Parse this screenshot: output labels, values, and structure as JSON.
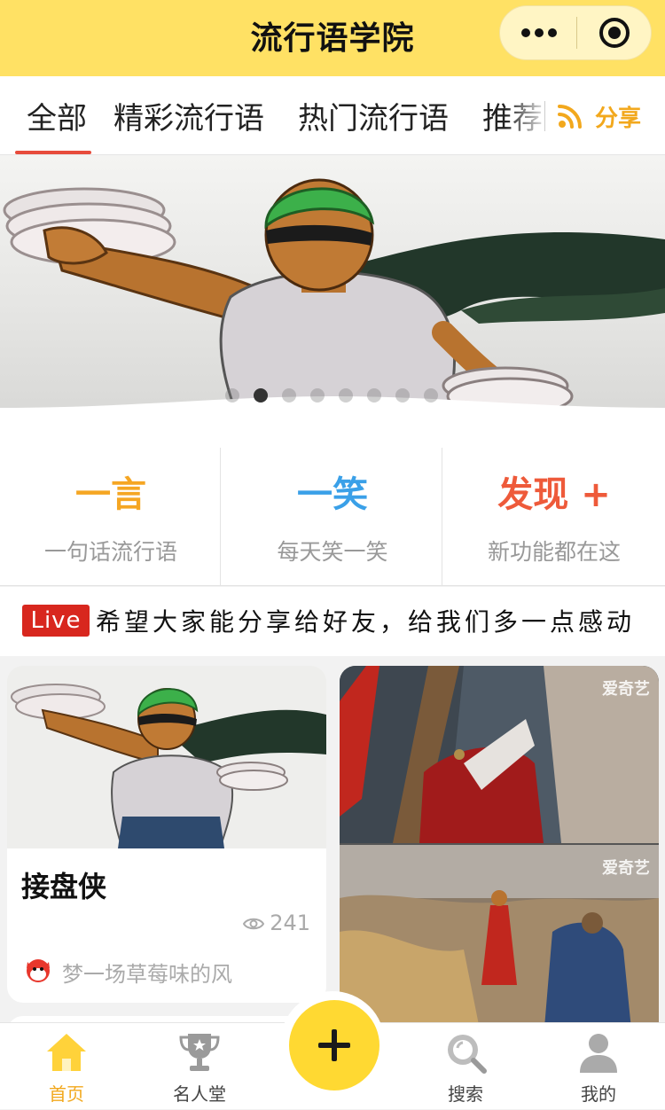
{
  "header": {
    "title": "流行语学院"
  },
  "tabs": {
    "items": [
      "全部",
      "精彩流行语",
      "热门流行语",
      "推荐"
    ],
    "active": "全部",
    "share_label": "分享"
  },
  "banner": {
    "slide_count": 8,
    "active_slide": 2
  },
  "features": [
    {
      "title": "一言",
      "subtitle": "一句话流行语",
      "color": "#f5a623"
    },
    {
      "title": "一笑",
      "subtitle": "每天笑一笑",
      "color": "#3aa0e8"
    },
    {
      "title": "发现 +",
      "subtitle": "新功能都在这",
      "color": "#ee5a3a"
    }
  ],
  "live": {
    "badge": "Live",
    "text": "希望大家能分享给好友，给我们多一点感动"
  },
  "cards": [
    {
      "title": "接盘侠",
      "views": "241",
      "author": "梦一场草莓味的风"
    },
    {
      "watermark_top": "爱奇艺",
      "watermark_bottom": "爱奇艺"
    }
  ],
  "bottom_nav": {
    "items": [
      {
        "label": "首页",
        "icon": "home-icon",
        "active": true
      },
      {
        "label": "名人堂",
        "icon": "trophy-icon",
        "active": false
      },
      {
        "label": "搜索",
        "icon": "search-icon",
        "active": false
      },
      {
        "label": "我的",
        "icon": "user-icon",
        "active": false
      }
    ]
  },
  "colors": {
    "accent_yellow": "#ffe164",
    "active_tab_line": "#e74c3c",
    "share": "#f2a81d",
    "live_badge": "#d8271e"
  }
}
